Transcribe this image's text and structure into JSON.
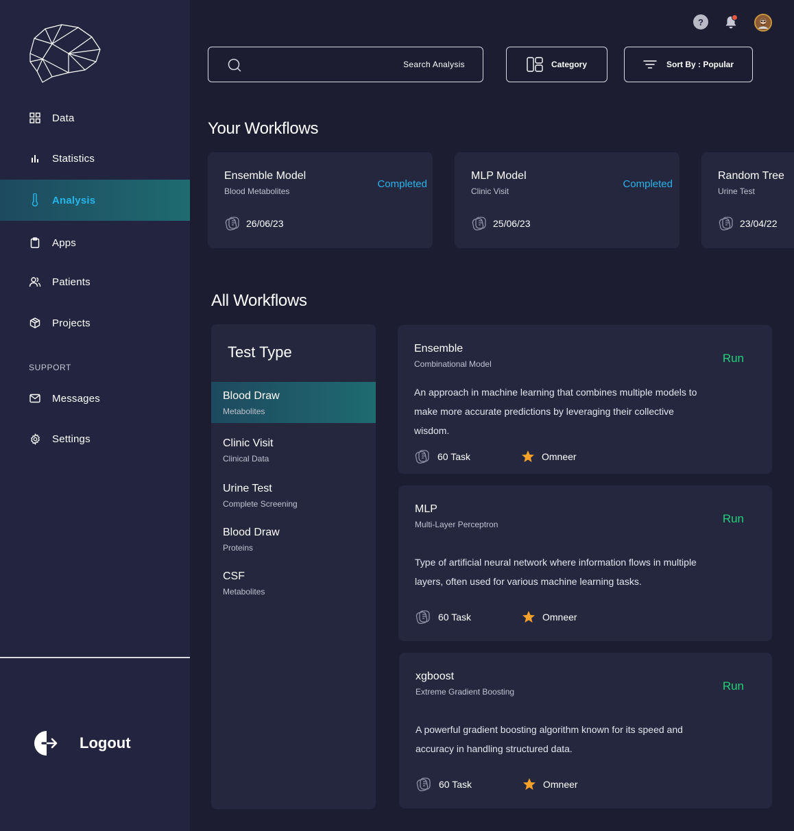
{
  "sidebar": {
    "items": [
      {
        "label": "Data",
        "icon": "grid-icon"
      },
      {
        "label": "Statistics",
        "icon": "bar-chart-icon"
      },
      {
        "label": "Analysis",
        "icon": "thermometer-icon"
      },
      {
        "label": "Apps",
        "icon": "clipboard-icon"
      },
      {
        "label": "Patients",
        "icon": "users-icon"
      },
      {
        "label": "Projects",
        "icon": "cube-icon"
      }
    ],
    "support_label": "SUPPORT",
    "support_items": [
      {
        "label": "Messages",
        "icon": "mail-icon"
      },
      {
        "label": "Settings",
        "icon": "gear-icon"
      }
    ],
    "logout_label": "Logout"
  },
  "header": {
    "help_glyph": "?"
  },
  "toolbar": {
    "search_placeholder": "Search  Analysis",
    "category_label": "Category",
    "sort_label": "Sort By : Popular"
  },
  "your_workflows": {
    "title": "Your Workflows",
    "cards": [
      {
        "name": "Ensemble Model",
        "sub": "Blood Metabolites",
        "status": "Completed",
        "date": "26/06/23"
      },
      {
        "name": "MLP Model",
        "sub": "Clinic Visit",
        "status": "Completed",
        "date": "25/06/23"
      },
      {
        "name": "Random Tree",
        "sub": "Urine Test",
        "status": "",
        "date": "23/04/22"
      }
    ]
  },
  "all_workflows": {
    "title": "All Workflows",
    "test_type_title": "Test Type",
    "test_types": [
      {
        "name": "Blood Draw",
        "sub": "Metabolites"
      },
      {
        "name": "Clinic Visit",
        "sub": "Clinical Data"
      },
      {
        "name": "Urine Test",
        "sub": "Complete Screening"
      },
      {
        "name": "Blood Draw",
        "sub": "Proteins"
      },
      {
        "name": "CSF",
        "sub": "Metabolites"
      }
    ],
    "models": [
      {
        "name": "Ensemble",
        "sub": "Combinational Model",
        "run": "Run",
        "desc": "An approach in machine learning that combines multiple models to make more accurate predictions by leveraging their collective wisdom.",
        "tasks": "60 Task",
        "owner": "Omneer"
      },
      {
        "name": "MLP",
        "sub": "Multi-Layer Perceptron",
        "run": "Run",
        "desc": "Type of artificial neural network where information flows in multiple layers, often used for various machine learning tasks.",
        "tasks": "60 Task",
        "owner": "Omneer"
      },
      {
        "name": "xgboost",
        "sub": "Extreme Gradient Boosting",
        "run": "Run",
        "desc": "A powerful gradient boosting algorithm known for its speed and accuracy in handling structured data.",
        "tasks": "60 Task",
        "owner": "Omneer"
      }
    ]
  },
  "colors": {
    "background": "#1c1d31",
    "sidebar": "#232540",
    "card": "#25273f",
    "accent_blue": "#27b4e8",
    "run_green": "#21d17a",
    "star_orange": "#f6a12a"
  }
}
